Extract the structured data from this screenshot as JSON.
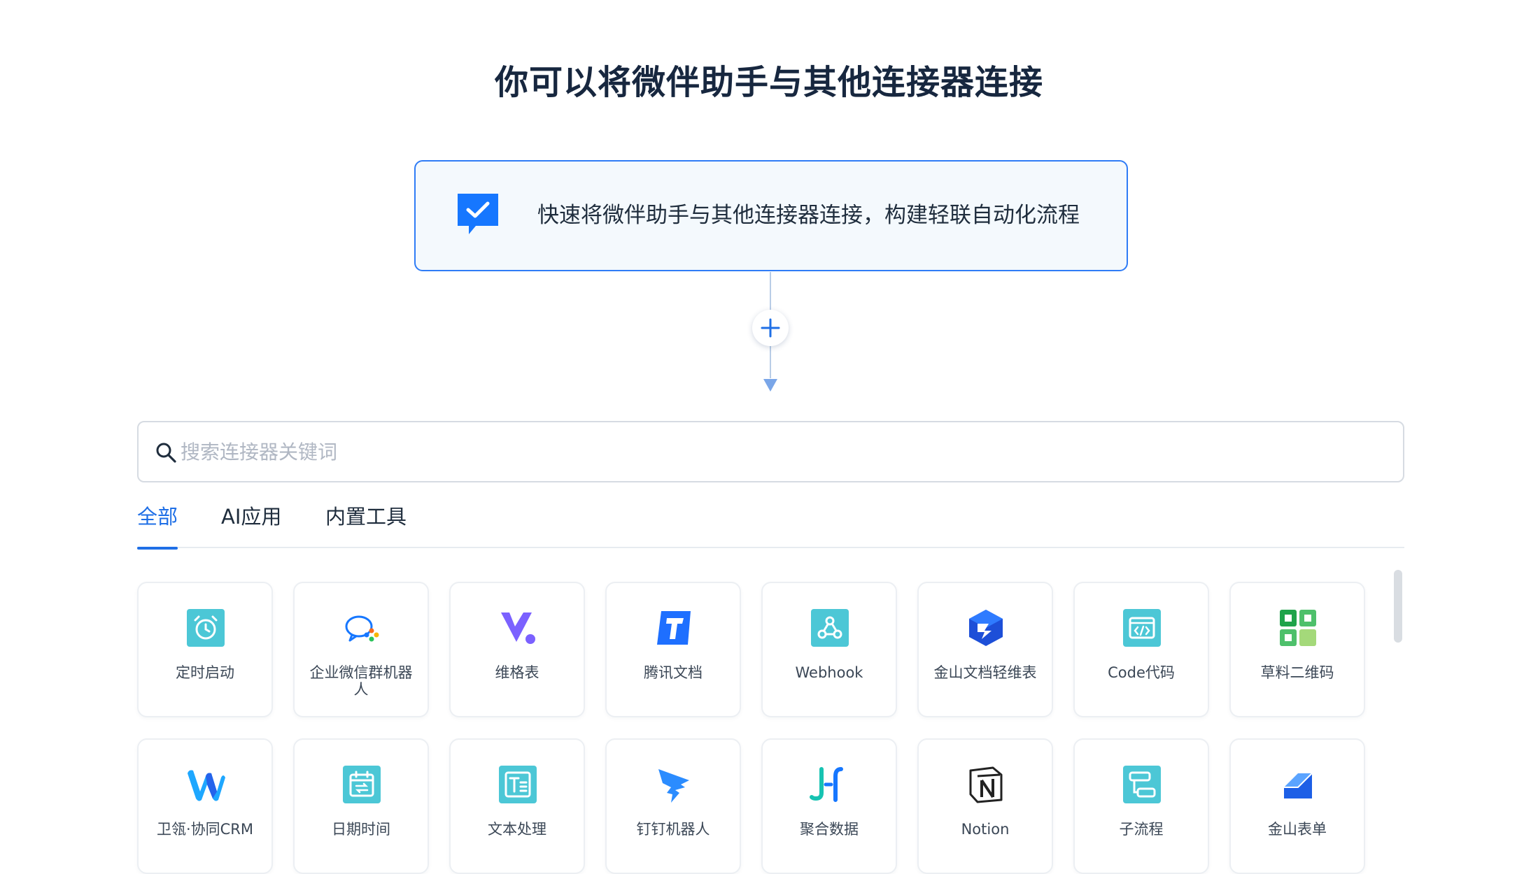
{
  "header": {
    "title": "你可以将微伴助手与其他连接器连接"
  },
  "trigger": {
    "text": "快速将微伴助手与其他连接器连接，构建轻联自动化流程",
    "icon": "chat-check-icon",
    "accent_color": "#1677ff"
  },
  "add_step": {
    "icon": "plus-icon"
  },
  "search": {
    "placeholder": "搜索连接器关键词",
    "value": ""
  },
  "tabs": [
    {
      "label": "全部",
      "active": true
    },
    {
      "label": "AI应用",
      "active": false
    },
    {
      "label": "内置工具",
      "active": false
    }
  ],
  "connectors": [
    {
      "label": "定时启动",
      "icon": "alarm-clock-icon"
    },
    {
      "label": "企业微信群机器人",
      "icon": "wecom-bot-icon"
    },
    {
      "label": "维格表",
      "icon": "vika-icon"
    },
    {
      "label": "腾讯文档",
      "icon": "tencent-docs-icon"
    },
    {
      "label": "Webhook",
      "icon": "webhook-icon"
    },
    {
      "label": "金山文档轻维表",
      "icon": "kdocs-table-icon"
    },
    {
      "label": "Code代码",
      "icon": "code-icon"
    },
    {
      "label": "草料二维码",
      "icon": "qrcode-icon"
    },
    {
      "label": "卫瓴·协同CRM",
      "icon": "weiling-crm-icon"
    },
    {
      "label": "日期时间",
      "icon": "calendar-icon"
    },
    {
      "label": "文本处理",
      "icon": "text-processing-icon"
    },
    {
      "label": "钉钉机器人",
      "icon": "dingtalk-icon"
    },
    {
      "label": "聚合数据",
      "icon": "juhe-data-icon"
    },
    {
      "label": "Notion",
      "icon": "notion-icon"
    },
    {
      "label": "子流程",
      "icon": "subflow-icon"
    },
    {
      "label": "金山表单",
      "icon": "kdocs-form-icon"
    }
  ]
}
